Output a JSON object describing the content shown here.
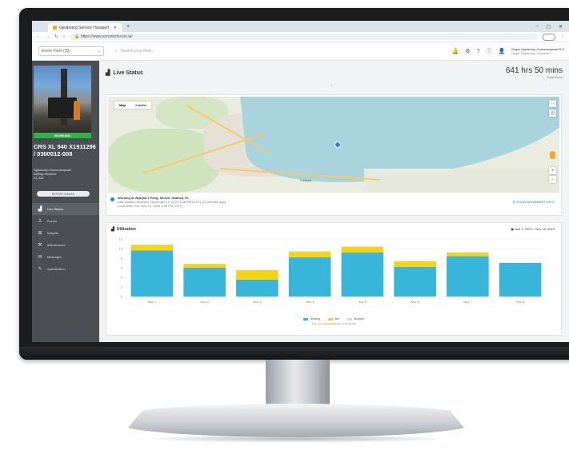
{
  "browser": {
    "tab_title": "Gjiuiboerg Service Hosspert",
    "url": "https://www.sonorlurlsosm.la/",
    "window_controls": [
      "–",
      "◻",
      "✕"
    ]
  },
  "header": {
    "fleet_select": "Entire Fleet (39)",
    "search_placeholder": "Search your fleet...",
    "user_name": "Bogar Gjadsorup Gosrsuampsak B.S",
    "user_company": "Bogar Gjadsorup Gosrsuen..."
  },
  "sidebar": {
    "status_badge": "WORKING",
    "machine_name": "CRS XL 940 X1911296 / 0300012-008",
    "owner_line1": "Gjadsorup Gosrsuampsak",
    "owner_line2": "Drilling Machine",
    "owner_line3": "XL 940",
    "report_button": "REPORT ISSUES",
    "nav": [
      {
        "label": "Live Status",
        "icon": "chart-icon"
      },
      {
        "label": "Events",
        "icon": "user-icon"
      },
      {
        "label": "Insights",
        "icon": "insights-icon"
      },
      {
        "label": "Maintenance",
        "icon": "wrench-icon"
      },
      {
        "label": "Messages",
        "icon": "message-icon"
      },
      {
        "label": "Specification",
        "icon": "edit-icon"
      }
    ]
  },
  "live": {
    "title": "Live Status",
    "hours": "641 hrs 50 mins",
    "hours_label": "Total hours"
  },
  "map": {
    "tab_map": "Map",
    "tab_satellite": "Satellite",
    "city_label": "Gdańsk",
    "location_title": "Working at Wężyka 1 Rzeg, 80-626, Gdańsk, PL",
    "location_line1": "Last position received: November 10, 2023 1:08 PM (UTC) (13 minutes ago)",
    "location_line2": "Local time: Tue, Nov 12, 2023 2:08 PM (CET)",
    "history_link": "SHOW MOVEMENT PATH"
  },
  "utilization": {
    "title": "Utilization",
    "date_range": "Nov 1, 2023 – Nov 15, 2023",
    "legend": [
      "Working",
      "Idle",
      "Stopped"
    ],
    "note": "Time zone: Europe/Warsaw (UTC+01:00)"
  },
  "chart_data": {
    "type": "bar",
    "stacked": true,
    "categories": [
      "Nov 1",
      "Nov 2",
      "Nov 3",
      "Nov 4",
      "Nov 5",
      "Nov 6",
      "Nov 7",
      "Nov 8"
    ],
    "series": [
      {
        "name": "Working",
        "values": [
          9.6,
          6.0,
          3.5,
          8.2,
          9.2,
          6.2,
          8.4,
          7.0
        ],
        "color": "#39b5d9"
      },
      {
        "name": "Idle",
        "values": [
          1.2,
          0.8,
          2.0,
          1.2,
          1.2,
          1.2,
          0.8,
          0
        ],
        "color": "#f4d31d"
      }
    ],
    "ylim": [
      0,
      12
    ],
    "yticks": [
      0,
      2,
      4,
      6,
      8,
      10,
      12
    ]
  }
}
